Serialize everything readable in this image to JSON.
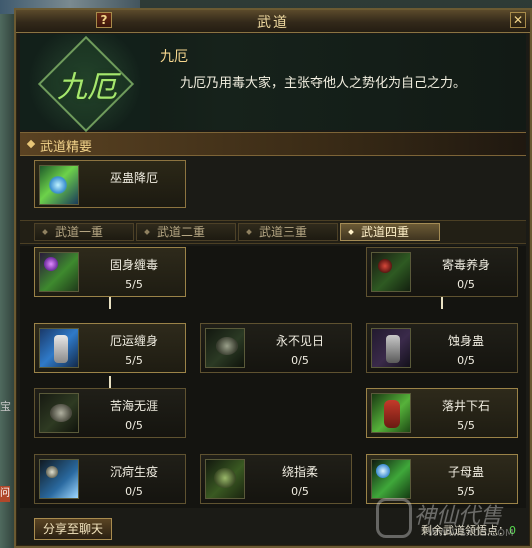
{
  "window": {
    "title": "武道",
    "help_label": "?",
    "close_label": "✕"
  },
  "header": {
    "emblem_text": "九厄",
    "skill_name": "九厄",
    "description": "九厄乃用毒大家，主张夺他人之势化为自己之力。"
  },
  "essentials": {
    "section_title": "武道精要",
    "card": {
      "name": "巫蛊降厄",
      "icon": "green-swirl-icon"
    }
  },
  "tabs": [
    {
      "label": "武道一重",
      "active": false
    },
    {
      "label": "武道二重",
      "active": false
    },
    {
      "label": "武道三重",
      "active": false
    },
    {
      "label": "武道四重",
      "active": true
    }
  ],
  "skills": {
    "r1c1": {
      "name": "固身缠毒",
      "value": "5/5",
      "icon": "purple-poison-icon"
    },
    "r1c3": {
      "name": "寄毒养身",
      "value": "0/5",
      "icon": "red-vine-icon"
    },
    "r2c1": {
      "name": "厄运缠身",
      "value": "5/5",
      "icon": "armored-arm-icon"
    },
    "r2c2": {
      "name": "永不见日",
      "value": "0/5",
      "icon": "dark-bug-icon"
    },
    "r2c3": {
      "name": "蚀身蛊",
      "value": "0/5",
      "icon": "purple-arm-icon"
    },
    "r3c1": {
      "name": "苦海无涯",
      "value": "0/5",
      "icon": "fist-icon"
    },
    "r3c3": {
      "name": "落井下石",
      "value": "5/5",
      "icon": "red-figure-icon"
    },
    "r4c1": {
      "name": "沉疴生疫",
      "value": "0/5",
      "icon": "blue-claw-icon"
    },
    "r4c2": {
      "name": "绕指柔",
      "value": "0/5",
      "icon": "green-hand-icon"
    },
    "r4c3": {
      "name": "子母蛊",
      "value": "5/5",
      "icon": "blue-orb-icon"
    }
  },
  "footer": {
    "share_label": "分享至聊天",
    "points_label": "剩余武道领悟点：",
    "points_value": "0"
  },
  "watermark": {
    "text": "神仙代售",
    "url": "WWW.SXDS.COM"
  },
  "side": {
    "badge": "问",
    "char": "宝"
  },
  "colors": {
    "gold": "#f1d28a",
    "learned_border": "#9b8348",
    "points_green": "#57d94f"
  }
}
